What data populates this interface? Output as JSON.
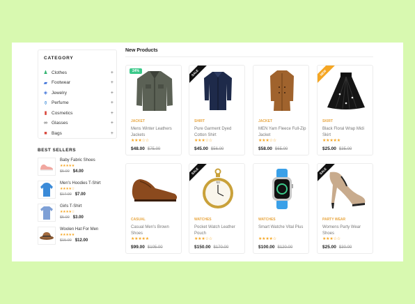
{
  "sidebar": {
    "category_title": "CATEGORY",
    "categories": [
      {
        "label": "Clothes",
        "icon": "dress-icon",
        "color": "#2fb36e"
      },
      {
        "label": "Footwear",
        "icon": "shoe-icon",
        "color": "#3a6fd8"
      },
      {
        "label": "Jewelry",
        "icon": "ring-icon",
        "color": "#3a6fd8"
      },
      {
        "label": "Perfume",
        "icon": "perfume-icon",
        "color": "#3a8ad8"
      },
      {
        "label": "Cosmetics",
        "icon": "lipstick-icon",
        "color": "#d8453a"
      },
      {
        "label": "Glasses",
        "icon": "glasses-icon",
        "color": "#333333"
      },
      {
        "label": "Bags",
        "icon": "bag-icon",
        "color": "#d8453a"
      }
    ],
    "best_sellers_title": "BEST SELLERS",
    "best_sellers": [
      {
        "name": "Baby Fabric Shoes",
        "old": "$5.00",
        "price": "$4.00",
        "stars": "★★★★★"
      },
      {
        "name": "Men's Hoodies T-Shirt",
        "old": "$17.00",
        "price": "$7.00",
        "stars": "★★★★☆"
      },
      {
        "name": "Girls T-Shirt",
        "old": "$5.00",
        "price": "$3.00",
        "stars": "★★★★☆"
      },
      {
        "name": "Woolen Hat For Men",
        "old": "$15.00",
        "price": "$12.00",
        "stars": "★★★★★"
      }
    ]
  },
  "main": {
    "title": "New Products",
    "products": [
      {
        "category": "JACKET",
        "name": "Mens Winter Leathers Jackets",
        "price": "$48.00",
        "old": "$75.00",
        "stars": "★★★☆☆",
        "badge": "24%",
        "ribbon": ""
      },
      {
        "category": "SHIRT",
        "name": "Pure Garment Dyed Cotton Shirt",
        "price": "$45.00",
        "old": "$56.00",
        "stars": "★★★☆☆",
        "badge": "",
        "ribbon": "SALE"
      },
      {
        "category": "JACKET",
        "name": "MEN Yarn Fleece Full-Zip Jacket",
        "price": "$58.00",
        "old": "$65.00",
        "stars": "★★★☆☆",
        "badge": "",
        "ribbon": ""
      },
      {
        "category": "SKIRT",
        "name": "Black Floral Wrap Midi Skirt",
        "price": "$25.00",
        "old": "$35.00",
        "stars": "★★★★★",
        "badge": "",
        "ribbon": "NEW"
      },
      {
        "category": "CASUAL",
        "name": "Casual Men's Brown Shoes",
        "price": "$99.00",
        "old": "$105.00",
        "stars": "★★★★★",
        "badge": "",
        "ribbon": ""
      },
      {
        "category": "WATCHES",
        "name": "Pocket Watch Leather Pouch",
        "price": "$150.00",
        "old": "$170.00",
        "stars": "★★★☆☆",
        "badge": "",
        "ribbon": "SALE"
      },
      {
        "category": "WATCHES",
        "name": "Smart Watche Vital Plus",
        "price": "$100.00",
        "old": "$120.00",
        "stars": "★★★★☆",
        "badge": "",
        "ribbon": ""
      },
      {
        "category": "PARTY WEAR",
        "name": "Womens Party Wear Shoes",
        "price": "$25.00",
        "old": "$30.00",
        "stars": "★★★☆☆",
        "badge": "",
        "ribbon": "SALE"
      }
    ]
  },
  "colors": {
    "background": "#d8f9b0",
    "accent": "#e8a640",
    "badge": "#3cc98a",
    "stars": "#f5a623"
  }
}
